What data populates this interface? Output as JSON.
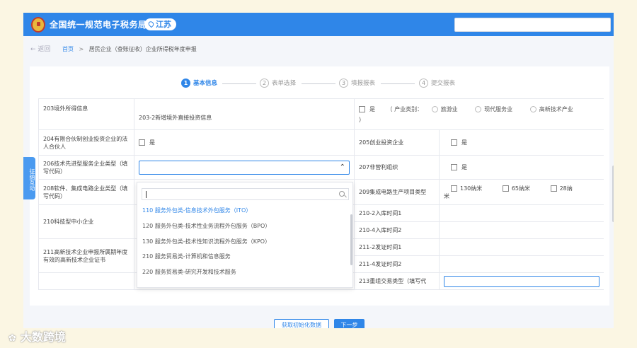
{
  "header": {
    "title": "全国统一规范电子税务局",
    "region": "江苏",
    "logo_text": "税"
  },
  "breadcrumb": {
    "back": "返回",
    "home": "首页",
    "separator": ">",
    "current": "居民企业（查账征收）企业所得税年度申报"
  },
  "steps": [
    {
      "num": "1",
      "label": "基本信息"
    },
    {
      "num": "2",
      "label": "表单选择"
    },
    {
      "num": "3",
      "label": "填报报表"
    },
    {
      "num": "4",
      "label": "提交报表"
    }
  ],
  "table": {
    "r203": {
      "label": "203境外所得信息",
      "sub_label": "203-2新增境外直接投资信息",
      "yes": "是",
      "industry_label": "（  产业类别：",
      "industries": [
        "旅游业",
        "现代服务业",
        "高新技术产业"
      ],
      "close": "）"
    },
    "r204": {
      "label": "204有限合伙制创业投资企业的法人合伙人",
      "yes": "是"
    },
    "r205": {
      "label": "205创业投资企业",
      "yes": "是"
    },
    "r206": {
      "label": "206技术先进型服务企业类型（填写代码）",
      "value": ""
    },
    "r207": {
      "label": "207非营利组织",
      "yes": "是"
    },
    "r208": {
      "label": "208软件、集成电路企业类型（填写代码）"
    },
    "r209": {
      "label": "209集成电路生产项目类型",
      "options": [
        "130纳米",
        "65纳米",
        "28纳"
      ],
      "wrap": "米"
    },
    "r210": {
      "label": "210科技型中小企业",
      "sub": [
        "210-2入库时间1",
        "210-4入库时间2"
      ]
    },
    "r211": {
      "label": "211高新技术企业申报所属期年度有效的高新技术企业证书",
      "sub": [
        "211-2发证时间1",
        "211-4发证时间2"
      ]
    },
    "r213": {
      "label": "213重组交易类型（填写代"
    }
  },
  "dropdown": {
    "search_value": "",
    "items": [
      "110 服务外包类-信息技术外包服务（ITO）",
      "120 服务外包类-技术性业务流程外包服务（BPO）",
      "130 服务外包类-技术性知识流程外包服务（KPO）",
      "210 服务贸易类-计算机和信息服务",
      "220 服务贸易类-研究开发和技术服务"
    ]
  },
  "footer": {
    "fetch_button": "获取初始化数据",
    "next_button": "下一步"
  },
  "side_tab": "征纳互动",
  "watermark": "大数跨境",
  "colors": {
    "accent": "#2f86e8",
    "background": "#fbf6e3"
  }
}
